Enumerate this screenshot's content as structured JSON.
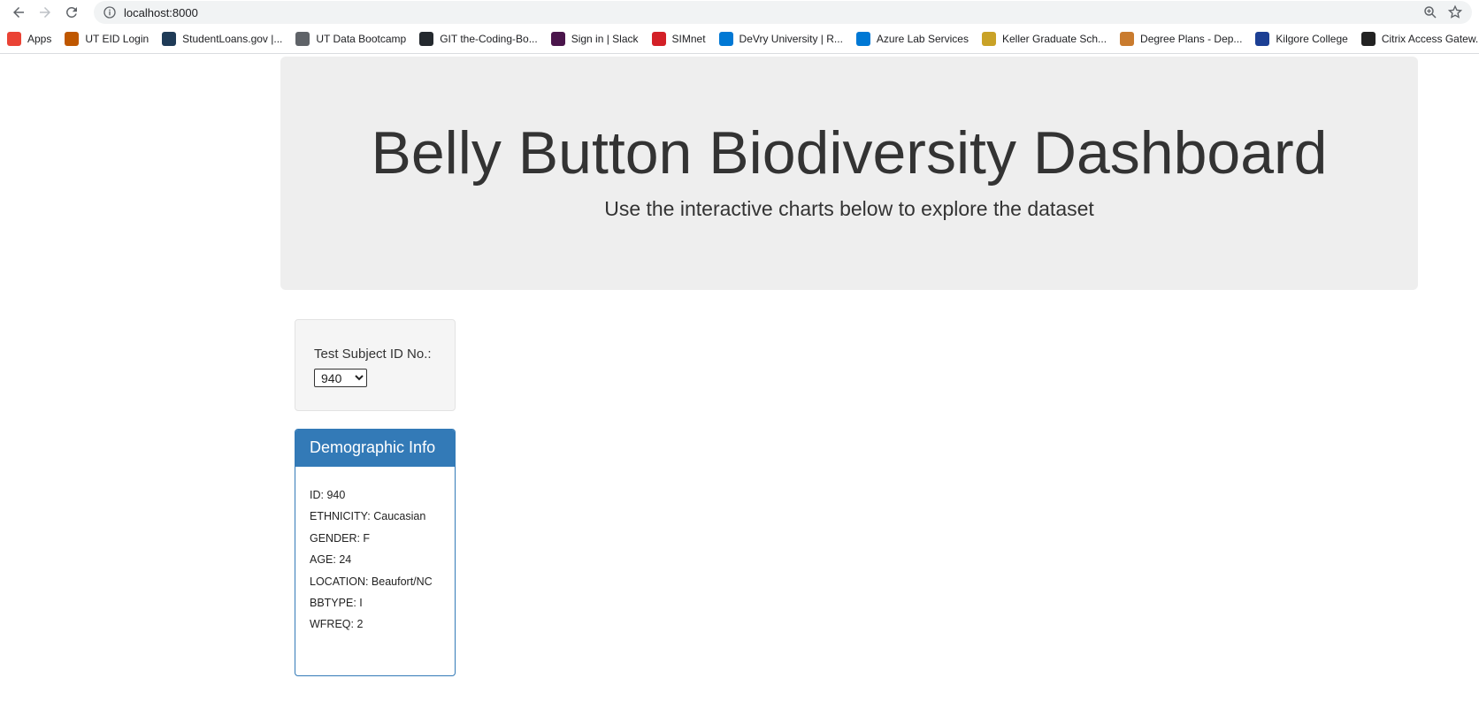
{
  "browser": {
    "url": "localhost:8000",
    "bookmarks": [
      {
        "label": "Apps",
        "icon": "apps-grid-icon",
        "color": "#ea4335"
      },
      {
        "label": "UT EID Login",
        "icon": "ut-tower-icon",
        "color": "#bf5700"
      },
      {
        "label": "StudentLoans.gov |...",
        "icon": "fsa-icon",
        "color": "#1f3b57"
      },
      {
        "label": "UT Data Bootcamp",
        "icon": "globe-icon",
        "color": "#5f6368"
      },
      {
        "label": "GIT the-Coding-Bo...",
        "icon": "github-icon",
        "color": "#24292e"
      },
      {
        "label": "Sign in | Slack",
        "icon": "slack-icon",
        "color": "#4a154b"
      },
      {
        "label": "SIMnet",
        "icon": "simnet-icon",
        "color": "#d32027"
      },
      {
        "label": "DeVry University | R...",
        "icon": "xm-icon",
        "color": "#0078d4"
      },
      {
        "label": "Azure Lab Services",
        "icon": "azure-icon",
        "color": "#0078d4"
      },
      {
        "label": "Keller Graduate Sch...",
        "icon": "keller-shield-icon",
        "color": "#c9a227"
      },
      {
        "label": "Degree Plans - Dep...",
        "icon": "degree-shield-icon",
        "color": "#c97b2e"
      },
      {
        "label": "Kilgore College",
        "icon": "kc-icon",
        "color": "#1c3f94"
      },
      {
        "label": "Citrix Access Gatew...",
        "icon": "citrix-icon",
        "color": "#222222"
      }
    ]
  },
  "header": {
    "title": "Belly Button Biodiversity Dashboard",
    "subtitle": "Use the interactive charts below to explore the dataset"
  },
  "selector": {
    "label": "Test Subject ID No.:",
    "selected": "940"
  },
  "demographics": {
    "heading": "Demographic Info",
    "rows": [
      "ID: 940",
      "ETHNICITY: Caucasian",
      "GENDER: F",
      "AGE: 24",
      "LOCATION: Beaufort/NC",
      "BBTYPE: I",
      "WFREQ: 2"
    ]
  },
  "colors": {
    "panel_primary": "#337ab7",
    "jumbotron_bg": "#eeeeee"
  }
}
